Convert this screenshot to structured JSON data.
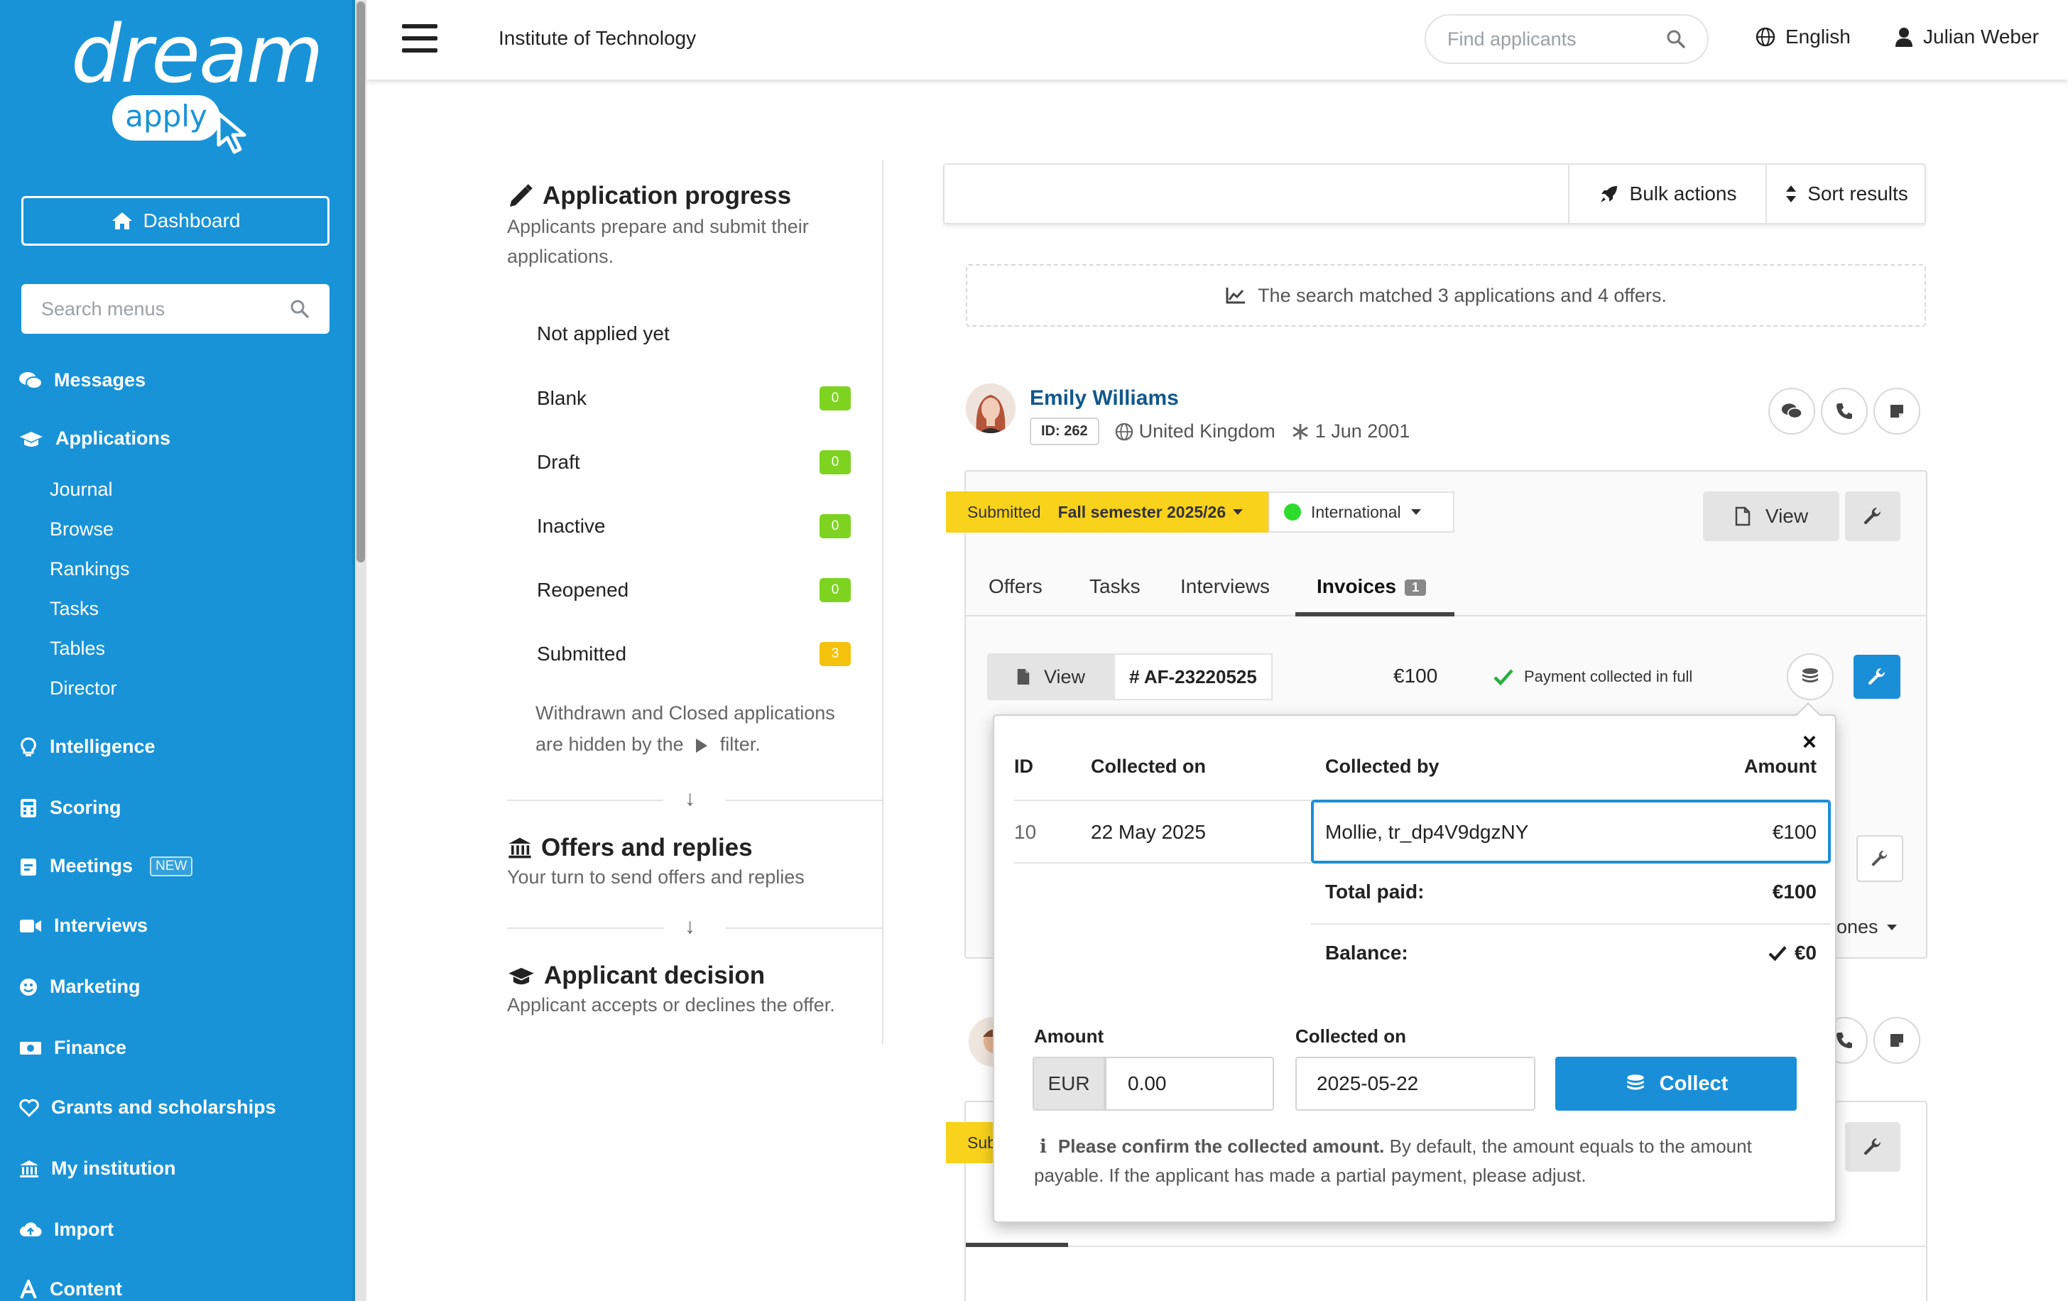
{
  "brand": {
    "line1": "dream",
    "line2": "apply"
  },
  "sidebar": {
    "dashboard_label": "Dashboard",
    "search_placeholder": "Search menus",
    "items": [
      {
        "label": "Messages",
        "icon": "comments-icon"
      },
      {
        "label": "Applications",
        "icon": "graduation-cap-icon"
      },
      {
        "label": "Intelligence",
        "icon": "lightbulb-icon"
      },
      {
        "label": "Scoring",
        "icon": "calculator-icon"
      },
      {
        "label": "Meetings",
        "icon": "calendar-icon",
        "badge": "NEW"
      },
      {
        "label": "Interviews",
        "icon": "video-icon"
      },
      {
        "label": "Marketing",
        "icon": "smile-icon"
      },
      {
        "label": "Finance",
        "icon": "money-icon"
      },
      {
        "label": "Grants and scholarships",
        "icon": "heart-icon"
      },
      {
        "label": "My institution",
        "icon": "institution-icon"
      },
      {
        "label": "Import",
        "icon": "cloud-upload-icon"
      },
      {
        "label": "Content",
        "icon": "font-icon"
      }
    ],
    "sub_items": [
      "Journal",
      "Browse",
      "Rankings",
      "Tasks",
      "Tables",
      "Director"
    ]
  },
  "topbar": {
    "institution": "Institute of Technology",
    "search_placeholder": "Find applicants",
    "language": "English",
    "user": "Julian Weber"
  },
  "progress": {
    "title": "Application progress",
    "subtitle": "Applicants prepare and submit their applications.",
    "not_applied": "Not applied yet",
    "statuses": [
      {
        "label": "Blank",
        "count": "0"
      },
      {
        "label": "Draft",
        "count": "0"
      },
      {
        "label": "Inactive",
        "count": "0"
      },
      {
        "label": "Reopened",
        "count": "0"
      },
      {
        "label": "Submitted",
        "count": "3"
      }
    ],
    "hint_part1": "Withdrawn and Closed applications are hidden by the",
    "hint_part2": "filter.",
    "offers_title": "Offers and replies",
    "offers_sub": "Your turn to send offers and replies",
    "decision_title": "Applicant decision",
    "decision_sub": "Applicant accepts or declines the offer."
  },
  "toolbar": {
    "bulk_actions": "Bulk actions",
    "sort_results": "Sort results"
  },
  "results_summary": "The search matched 3 applications and 4 offers.",
  "applicant": {
    "name": "Emily Williams",
    "id": "ID: 262",
    "country": "United Kingdom",
    "birth": "1 Jun 2001",
    "status": "Submitted",
    "semester": "Fall semester 2025/26",
    "track": "International",
    "view_label": "View",
    "tabs": [
      "Offers",
      "Tasks",
      "Interviews",
      "Invoices"
    ],
    "invoices_count": "1",
    "invoice": {
      "view_label": "View",
      "number": "# AF-23220525",
      "amount": "€100",
      "status": "Payment collected in full"
    }
  },
  "popover": {
    "close": "×",
    "headers": {
      "id": "ID",
      "collected_on": "Collected on",
      "collected_by": "Collected by",
      "amount": "Amount"
    },
    "row": {
      "id": "10",
      "collected_on": "22 May 2025",
      "collected_by": "Mollie, tr_dp4V9dgzNY",
      "amount": "€100"
    },
    "total_label": "Total paid:",
    "total_value": "€100",
    "balance_label": "Balance:",
    "balance_value": "€0",
    "amount_label": "Amount",
    "currency": "EUR",
    "amount_value": "0.00",
    "date_label": "Collected on",
    "date_value": "2025-05-22",
    "collect_label": "Collect",
    "note_bold": "Please confirm the collected amount.",
    "note_rest": " By default, the amount equals to the amount payable. If the applicant has made a partial payment, please adjust."
  },
  "background": {
    "milestones_fragment": "ones",
    "second_status_fragment": "Sub"
  },
  "colors": {
    "sidebar": "#1893d8",
    "accent": "#1a8fd8",
    "status_yellow": "#f8d21b",
    "count_green": "#7ed321",
    "name_blue": "#11578c"
  }
}
